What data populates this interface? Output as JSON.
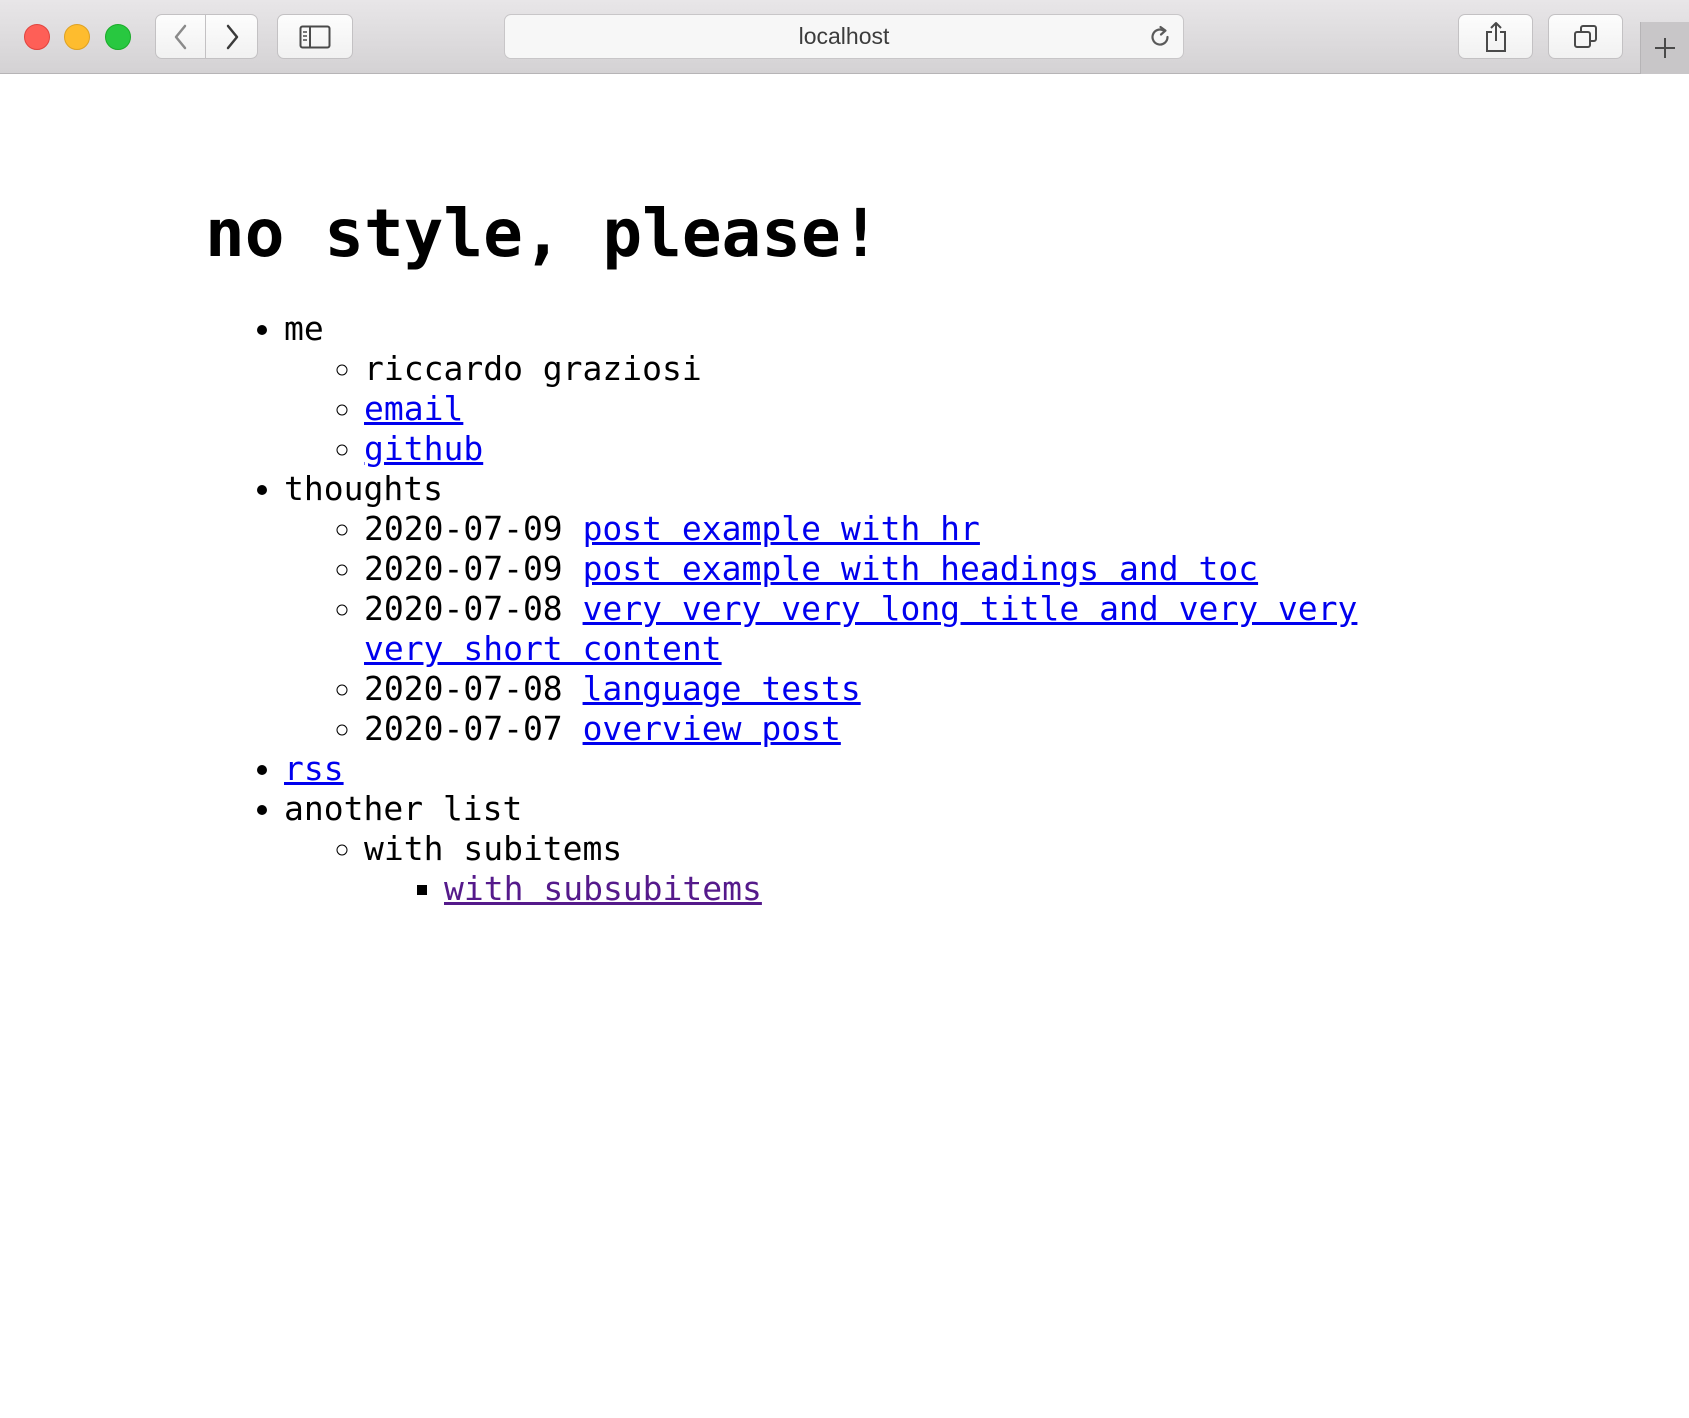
{
  "browser": {
    "address": "localhost",
    "icons": {
      "back": "chevron-left-icon",
      "forward": "chevron-right-icon",
      "sidebar": "sidebar-icon",
      "reload": "reload-icon",
      "share": "share-icon",
      "tabs": "tabs-overview-icon",
      "new_tab": "plus-icon"
    }
  },
  "page": {
    "title": "no style, please!",
    "me": {
      "label": "me",
      "name": "riccardo graziosi",
      "email": "email",
      "github": "github"
    },
    "thoughts": {
      "label": "thoughts",
      "posts": [
        {
          "date": "2020-07-09",
          "title": "post example with hr"
        },
        {
          "date": "2020-07-09",
          "title": "post example with headings and toc"
        },
        {
          "date": "2020-07-08",
          "title": "very very very long title and very very very short content"
        },
        {
          "date": "2020-07-08",
          "title": "language tests"
        },
        {
          "date": "2020-07-07",
          "title": "overview post"
        }
      ]
    },
    "rss": "rss",
    "another_list": {
      "label": "another list",
      "subitem": "with subitems",
      "subsubitem": "with subsubitems"
    }
  },
  "colors": {
    "link": "#0000ee",
    "visited_link": "#551a8b",
    "close": "#fe5f57",
    "minimize": "#febc2e",
    "zoom": "#28c840"
  }
}
